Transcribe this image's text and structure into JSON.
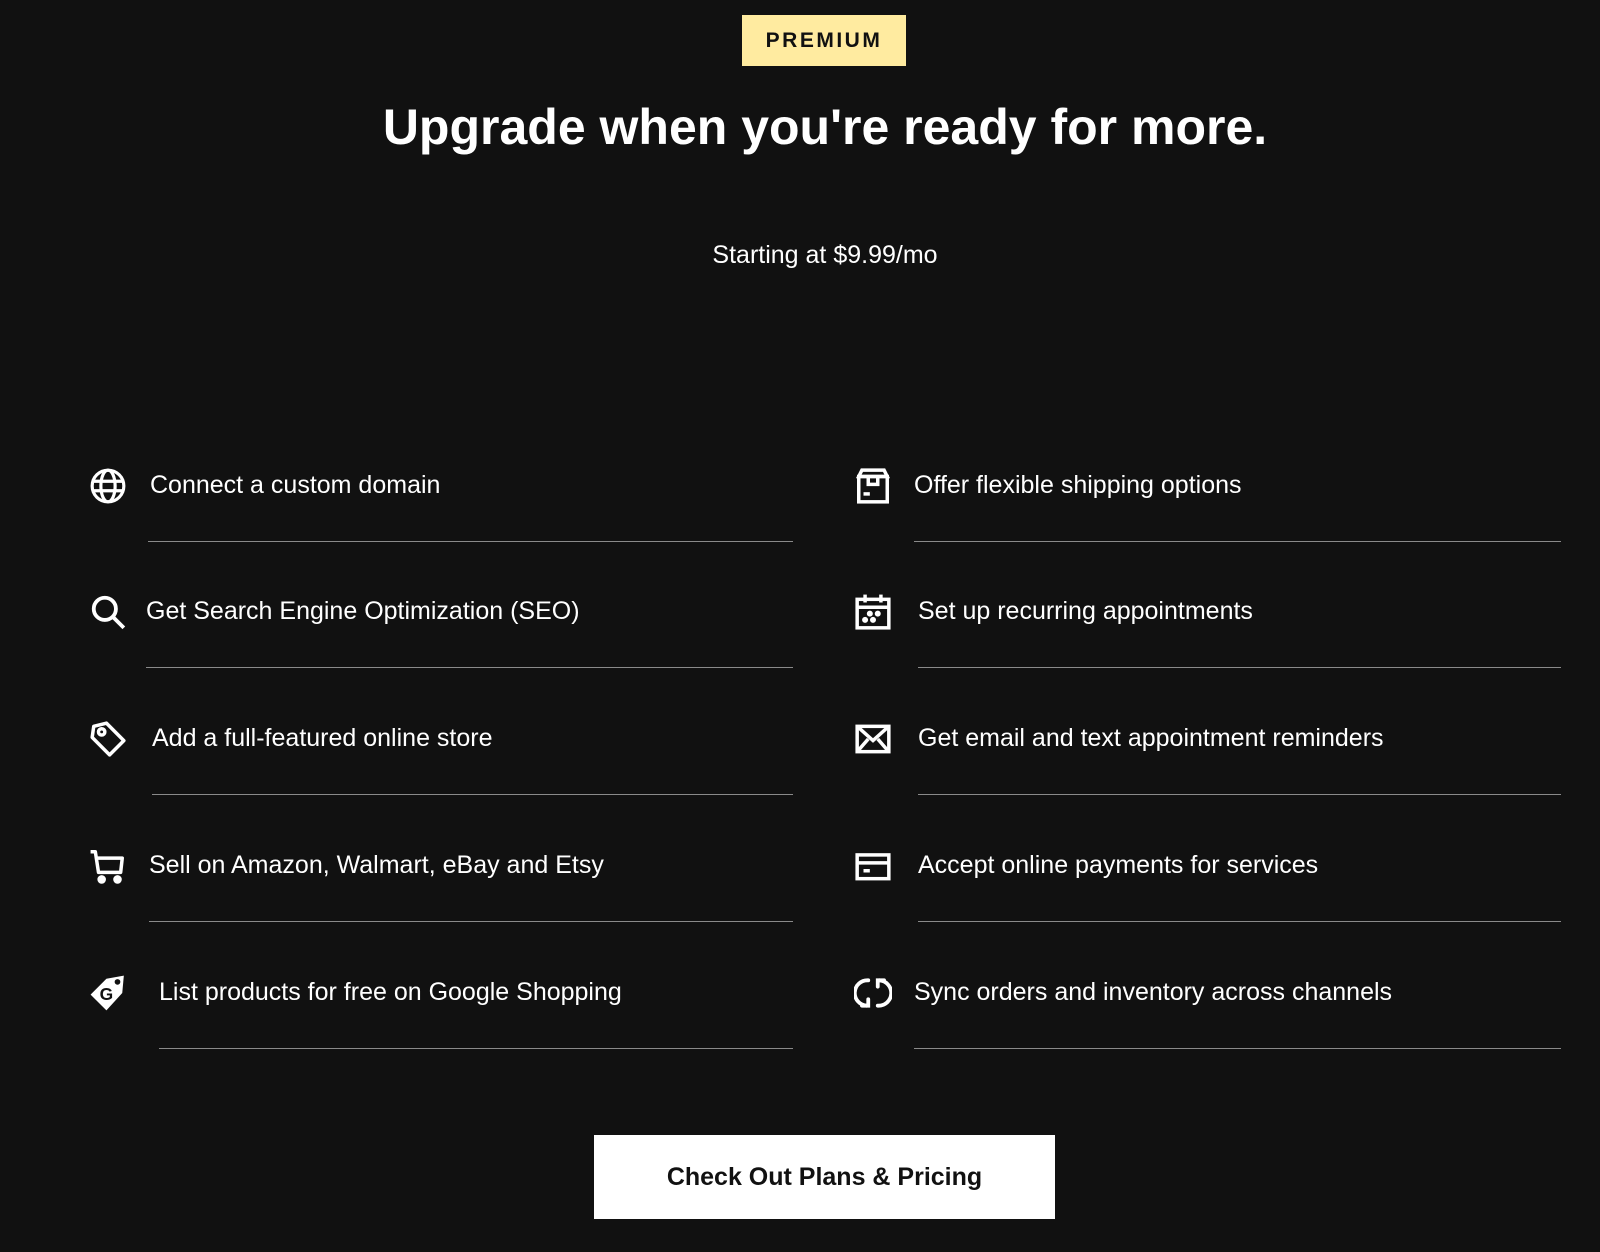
{
  "header": {
    "badge": "PREMIUM",
    "title": "Upgrade when you're ready for more.",
    "subtitle": "Starting at $9.99/mo"
  },
  "features": {
    "left": [
      {
        "icon": "globe-icon",
        "label": "Connect a custom domain"
      },
      {
        "icon": "search-icon",
        "label": "Get Search Engine Optimization (SEO)"
      },
      {
        "icon": "tag-icon",
        "label": "Add a full-featured online store"
      },
      {
        "icon": "cart-icon",
        "label": "Sell on Amazon, Walmart, eBay and Etsy"
      },
      {
        "icon": "google-tag-icon",
        "label": "List products for free on Google Shopping"
      }
    ],
    "right": [
      {
        "icon": "shipping-box-icon",
        "label": "Offer flexible shipping options"
      },
      {
        "icon": "calendar-icon",
        "label": "Set up recurring appointments"
      },
      {
        "icon": "envelope-icon",
        "label": "Get email and text appointment reminders"
      },
      {
        "icon": "credit-card-icon",
        "label": "Accept online payments for services"
      },
      {
        "icon": "sync-icon",
        "label": "Sync orders and inventory across channels"
      }
    ]
  },
  "cta": {
    "label": "Check Out Plans & Pricing"
  },
  "colors": {
    "background": "#111111",
    "badge": "#ffeba0",
    "text": "#ffffff",
    "button": "#ffffff"
  }
}
